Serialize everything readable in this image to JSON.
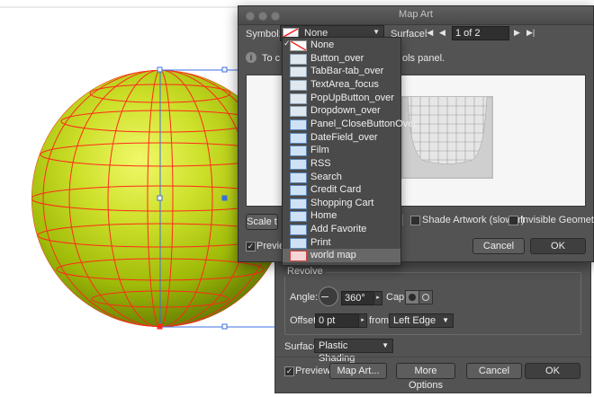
{
  "map_art": {
    "title": "Map Art",
    "symbol_label": "Symbol:",
    "symbol_value": "None",
    "surface_label": "Surface:",
    "surface_value": "1 of 2",
    "info_text_left": "To c",
    "info_text_right": "ols panel.",
    "scale_button": "Scale t",
    "shade_artwork_label": "Shade Artwork (slower)",
    "invisible_geometry_label": "Invisible Geometry",
    "preview_label": "Preview",
    "cancel_label": "Cancel",
    "ok_label": "OK"
  },
  "symbol_menu": {
    "items": [
      {
        "label": "None",
        "icon": "none-swatch-icon",
        "checked": true
      },
      {
        "label": "Button_over",
        "icon": "button-symbol-icon"
      },
      {
        "label": "TabBar-tab_over",
        "icon": "tab-symbol-icon"
      },
      {
        "label": "TextArea_focus",
        "icon": "textarea-symbol-icon"
      },
      {
        "label": "PopUpButton_over",
        "icon": "popup-symbol-icon"
      },
      {
        "label": "Dropdown_over",
        "icon": "dropdown-symbol-icon"
      },
      {
        "label": "Panel_CloseButtonOver",
        "icon": "close-symbol-icon"
      },
      {
        "label": "DateField_over",
        "icon": "datefield-symbol-icon"
      },
      {
        "label": "Film",
        "icon": "film-icon"
      },
      {
        "label": "RSS",
        "icon": "rss-icon"
      },
      {
        "label": "Search",
        "icon": "search-icon"
      },
      {
        "label": "Credit Card",
        "icon": "credit-card-icon"
      },
      {
        "label": "Shopping Cart",
        "icon": "shopping-cart-icon"
      },
      {
        "label": "Home",
        "icon": "home-icon"
      },
      {
        "label": "Add Favorite",
        "icon": "add-favorite-icon"
      },
      {
        "label": "Print",
        "icon": "print-icon"
      },
      {
        "label": "world map",
        "icon": "world-map-icon",
        "selected": true
      }
    ]
  },
  "revolve": {
    "section_title": "Revolve",
    "angle_label": "Angle:",
    "angle_value": "360°",
    "cap_label": "Cap:",
    "offset_label": "Offset:",
    "offset_value": "0 pt",
    "from_label": "from",
    "from_value": "Left Edge",
    "surface_label": "Surface:",
    "surface_value": "Plastic Shading",
    "preview_label": "Preview",
    "map_art_button": "Map Art...",
    "more_options_button": "More Options",
    "cancel_label": "Cancel",
    "ok_label": "OK"
  },
  "colors": {
    "panel": "#535353",
    "sphere_highlight": "#e6f25a",
    "sphere_shadow": "#6f8a00",
    "wireframe": "#ff2a1a",
    "selection": "#3b6fe0"
  }
}
